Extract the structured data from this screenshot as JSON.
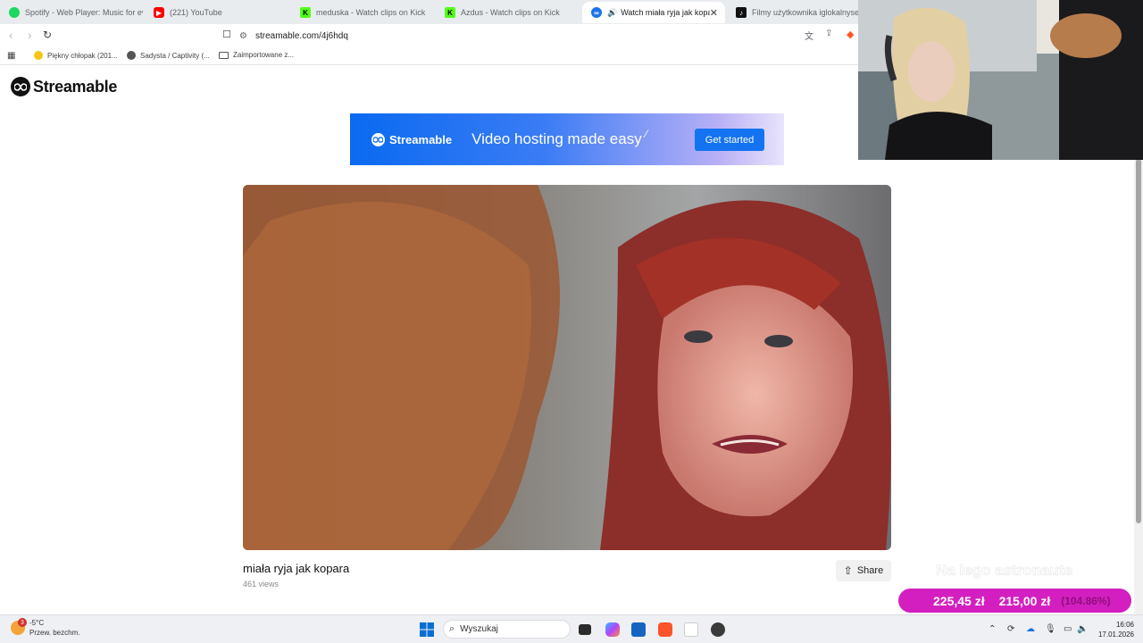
{
  "tabs": [
    {
      "label": "Spotify - Web Player: Music for every",
      "icon": "spotify-icon",
      "color": "#1ed760"
    },
    {
      "label": "(221) YouTube",
      "icon": "youtube-icon",
      "color": "#ff0000"
    },
    {
      "label": "meduska - Watch clips on Kick",
      "icon": "kick-icon",
      "color": "#53fc18"
    },
    {
      "label": "Azdus - Watch clips on Kick",
      "icon": "kick-icon",
      "color": "#53fc18"
    },
    {
      "label": "Watch miała ryja jak kopara |",
      "icon": "streamable-icon",
      "color": "#1a73e8",
      "active": true
    },
    {
      "label": "Filmy użytkownika iglokalnyseba (i",
      "icon": "tiktok-icon",
      "color": "#111111"
    }
  ],
  "address": {
    "url": "streamable.com/4j6hdq"
  },
  "bookmarks": [
    {
      "label": "Piękny chłopak (201...",
      "icon": "emoji-icon"
    },
    {
      "label": "Sadysta / Captivity (...",
      "icon": "globe-icon"
    },
    {
      "label": "Zaimportowane z...",
      "icon": "folder-icon"
    }
  ],
  "site": {
    "brand": "Streamable",
    "banner": {
      "brand": "Streamable",
      "headline": "Video hosting made easy",
      "cta": "Get started"
    },
    "video": {
      "title": "miała ryja jak kopara",
      "views": "461 views",
      "share_label": "Share"
    }
  },
  "stream_overlay": {
    "text": "Na lego astronaute",
    "donation_current": "225,45 zł",
    "donation_goal": "215,00 zł",
    "donation_percent": "(104.86%)"
  },
  "taskbar": {
    "weather_temp": "-5°C",
    "weather_desc": "Przew. bezchm.",
    "weather_badge": "3",
    "search_placeholder": "Wyszukaj",
    "time": "16:06",
    "date": "17.01.2026"
  },
  "colors": {
    "accent": "#1473f0",
    "donation": "#d31fc0"
  }
}
